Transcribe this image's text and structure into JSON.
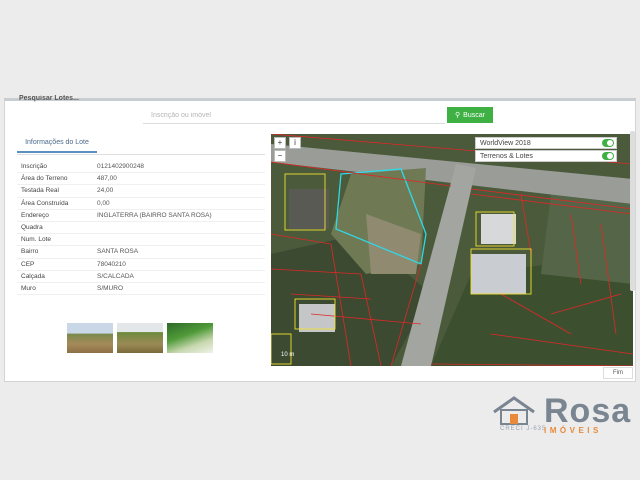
{
  "header": {
    "cut_title": "Pesquisar Lotes..."
  },
  "search": {
    "placeholder": "Inscrição ou imóvel",
    "button_label": "Buscar"
  },
  "tab": {
    "label": "Informações do Lote"
  },
  "info": [
    {
      "label": "Inscrição",
      "value": "0121402900248"
    },
    {
      "label": "Área do Terreno",
      "value": "487,00"
    },
    {
      "label": "Testada Real",
      "value": "24,00"
    },
    {
      "label": "Área Construída",
      "value": "0,00"
    },
    {
      "label": "Endereço",
      "value": "INGLATERRA (BAIRRO SANTA ROSA)"
    },
    {
      "label": "Quadra",
      "value": ""
    },
    {
      "label": "Num. Lote",
      "value": ""
    },
    {
      "label": "Bairro",
      "value": "SANTA ROSA"
    },
    {
      "label": "CEP",
      "value": "78040210"
    },
    {
      "label": "Calçada",
      "value": "S/CALCADA"
    },
    {
      "label": "Muro",
      "value": "S/MURO"
    }
  ],
  "map": {
    "layers": [
      {
        "label": "WorldView 2018"
      },
      {
        "label": "Terrenos & Lotes"
      }
    ],
    "scale": "10 m",
    "attribution": "Fim",
    "zoom_in": "+",
    "zoom_out": "−"
  },
  "logo": {
    "name": "Rosa",
    "creci": "CRECI J-635",
    "sub": "IMÓVEIS"
  },
  "colors": {
    "accent": "#3fb144",
    "lot_highlight": "#30d8e8",
    "parcel_lines": "#e02828",
    "building_lines": "#f0e030"
  }
}
